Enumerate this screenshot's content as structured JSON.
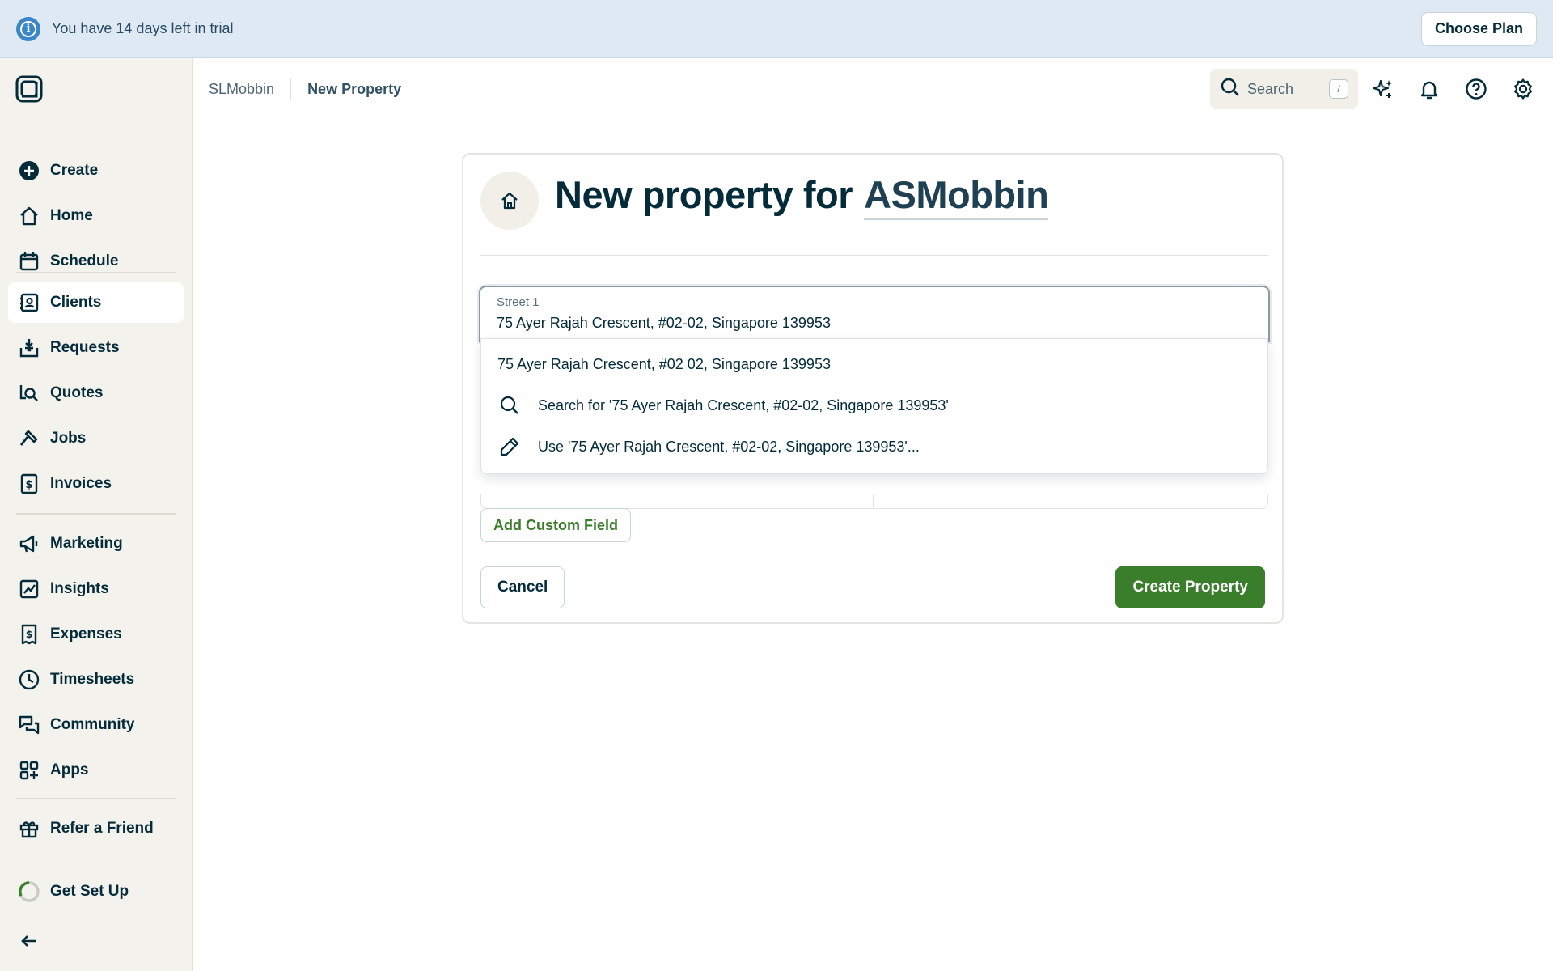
{
  "banner": {
    "message": "You have 14 days left in trial",
    "choose_plan": "Choose Plan",
    "icon": "info-icon"
  },
  "sidebar": {
    "items": [
      {
        "label": "Create",
        "icon": "plus-circle-icon"
      },
      {
        "label": "Home",
        "icon": "home-icon"
      },
      {
        "label": "Schedule",
        "icon": "calendar-icon"
      },
      {
        "label": "Clients",
        "icon": "contacts-icon",
        "active": true
      },
      {
        "label": "Requests",
        "icon": "inbox-download-icon"
      },
      {
        "label": "Quotes",
        "icon": "quote-search-icon"
      },
      {
        "label": "Jobs",
        "icon": "hammer-icon"
      },
      {
        "label": "Invoices",
        "icon": "dollar-document-icon"
      },
      {
        "label": "Marketing",
        "icon": "megaphone-icon"
      },
      {
        "label": "Insights",
        "icon": "chart-icon"
      },
      {
        "label": "Expenses",
        "icon": "receipt-icon"
      },
      {
        "label": "Timesheets",
        "icon": "clock-icon"
      },
      {
        "label": "Community",
        "icon": "chat-icon"
      },
      {
        "label": "Apps",
        "icon": "apps-grid-icon"
      },
      {
        "label": "Refer a Friend",
        "icon": "gift-icon"
      },
      {
        "label": "Get Set Up",
        "icon": "progress-ring-icon"
      }
    ],
    "collapse_icon": "arrow-left-icon"
  },
  "topbar": {
    "breadcrumb": [
      "SLMobbin",
      "New Property"
    ],
    "search_label": "Search",
    "search_shortcut": "/",
    "icons": [
      "sparkles-icon",
      "bell-icon",
      "help-icon",
      "gear-icon"
    ]
  },
  "form": {
    "title_prefix": "New property for",
    "client_name": "ASMobbin",
    "street_label": "Street 1",
    "street_value": "75 Ayer Rajah Crescent, #02-02, Singapore 139953",
    "suggestions": [
      {
        "text": "75 Ayer Rajah Crescent, #02 02, Singapore 139953",
        "icon": ""
      },
      {
        "text": "Search for '75 Ayer Rajah Crescent, #02-02, Singapore 139953'",
        "icon": "search-icon"
      },
      {
        "text": "Use '75 Ayer Rajah Crescent, #02-02, Singapore 139953'...",
        "icon": "pencil-icon"
      }
    ],
    "add_custom_field": "Add Custom Field",
    "cancel": "Cancel",
    "create": "Create Property"
  },
  "colors": {
    "brand_green": "#3a7d2a",
    "navy": "#032b3a",
    "sidebar_bg": "#f4f2ec",
    "banner_bg": "#dfe9f3",
    "info_blue": "#3a86c8"
  }
}
